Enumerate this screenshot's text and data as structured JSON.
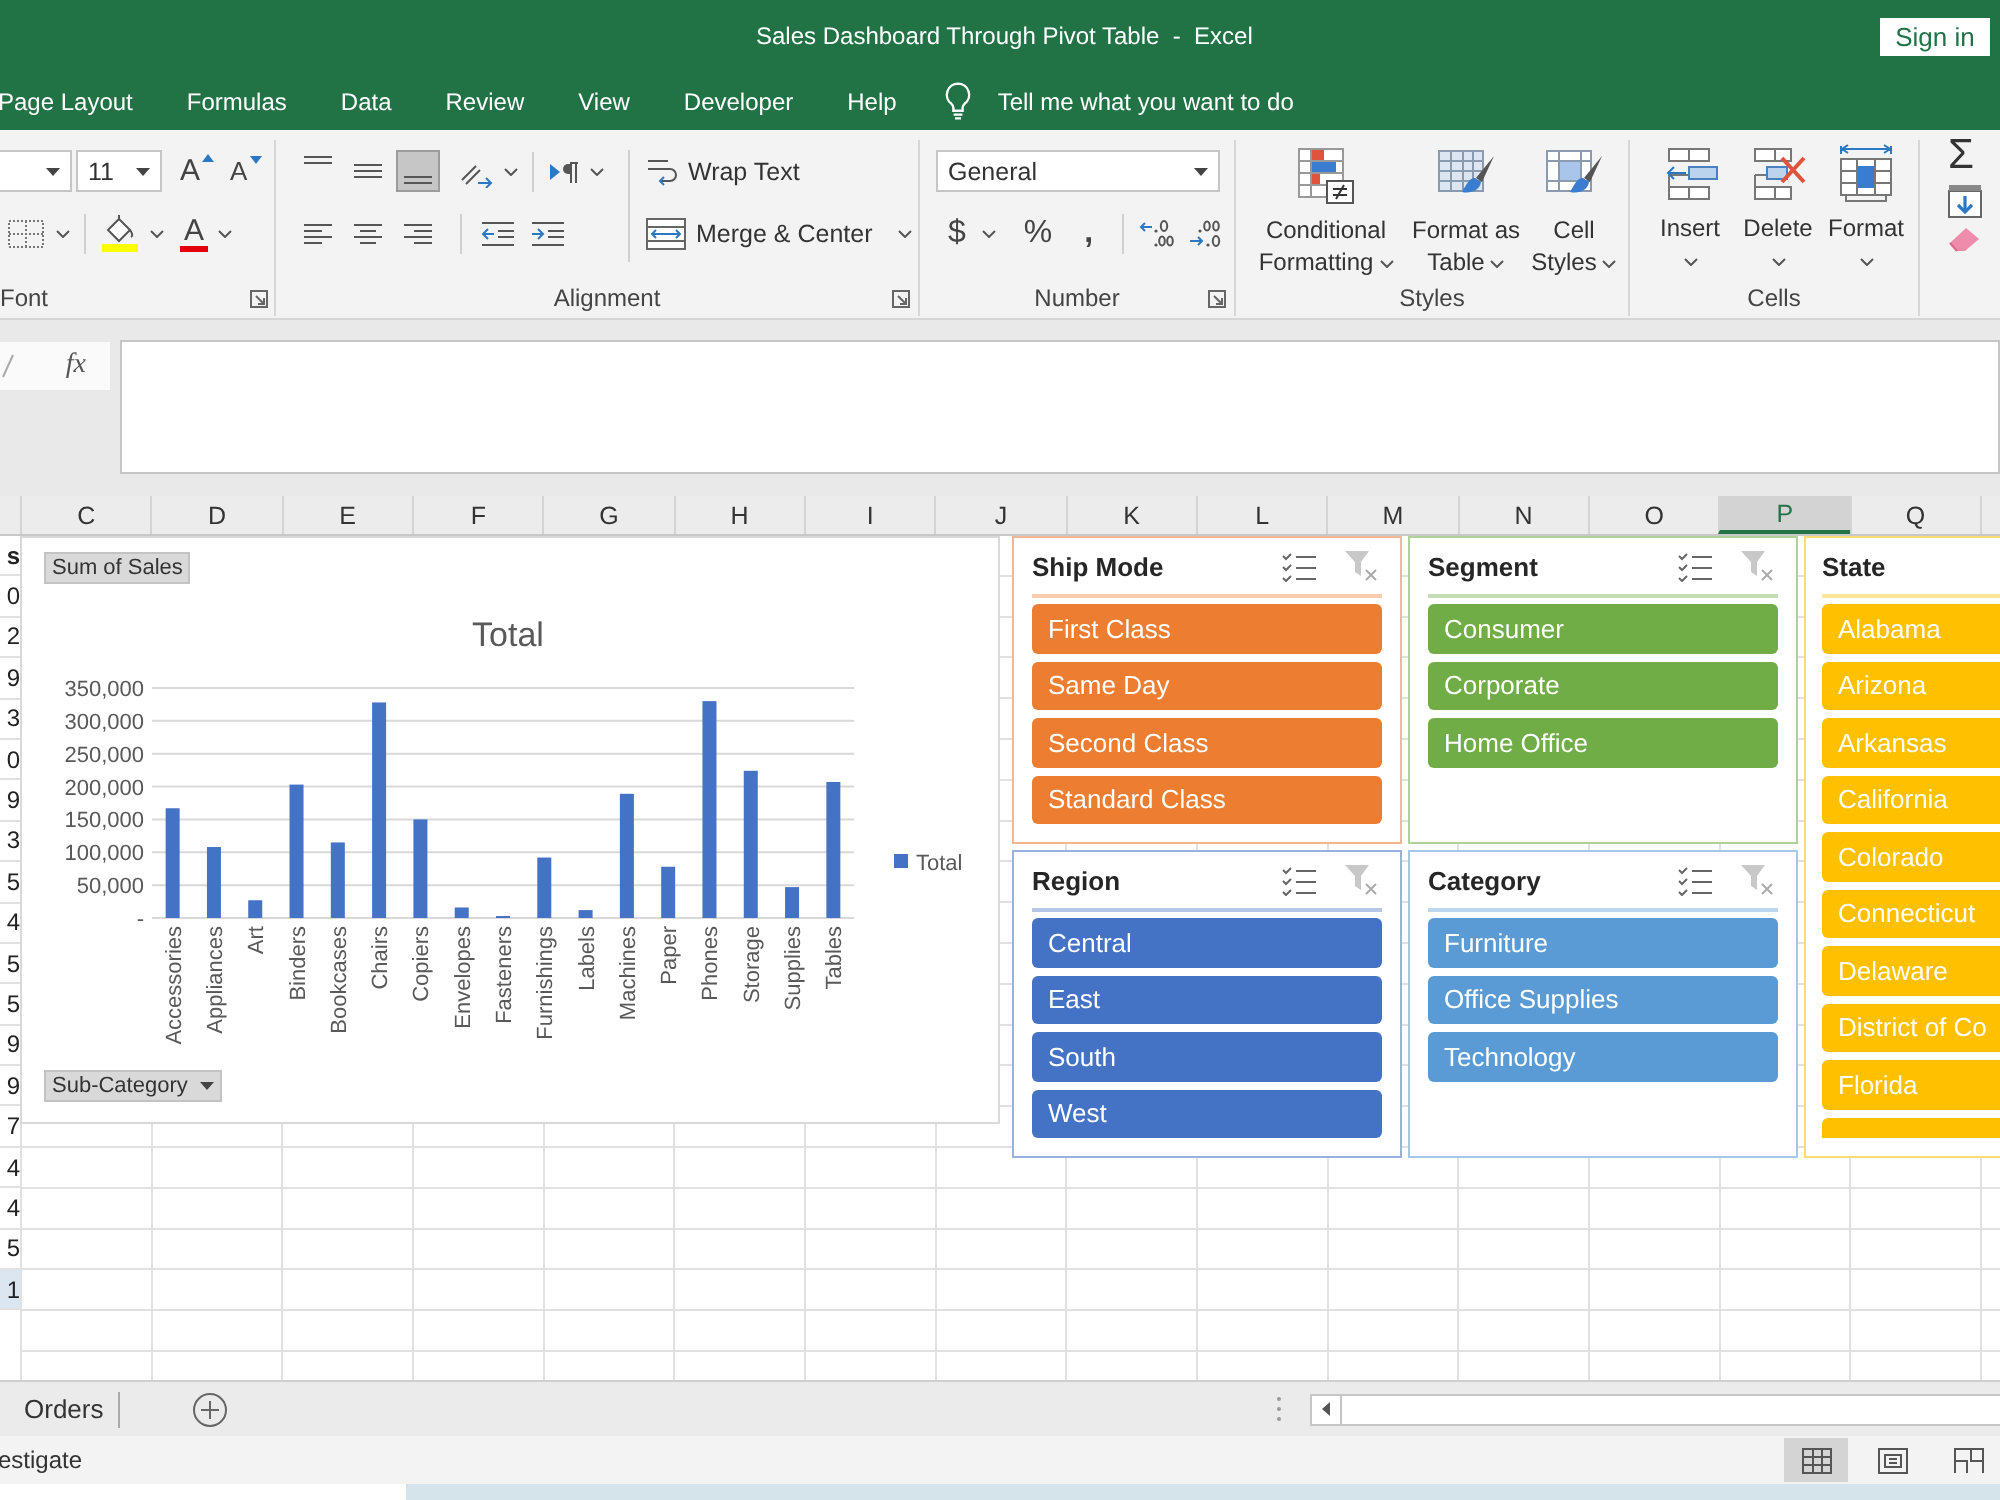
{
  "window": {
    "title": "Sales Dashboard Through Pivot Table  -  Excel",
    "sign_in": "Sign in"
  },
  "menu_tabs": [
    {
      "label": "Page Layout",
      "selected": false
    },
    {
      "label": "Formulas",
      "selected": false
    },
    {
      "label": "Data",
      "selected": false
    },
    {
      "label": "Review",
      "selected": false
    },
    {
      "label": "View",
      "selected": false
    },
    {
      "label": "Developer",
      "selected": false
    },
    {
      "label": "Help",
      "selected": false
    }
  ],
  "tell_me": {
    "label": "Tell me what you want to do"
  },
  "ribbon": {
    "font": {
      "label": "Font",
      "size": "11",
      "grow": "A",
      "shrink": "A",
      "font_color": "A"
    },
    "alignment": {
      "label": "Alignment",
      "vertical": [
        {
          "kind": "top",
          "selected": false
        },
        {
          "kind": "middle",
          "selected": false
        },
        {
          "kind": "bottom",
          "selected": true
        }
      ],
      "horizontal": [
        {
          "kind": "left",
          "selected": false
        },
        {
          "kind": "center",
          "selected": false
        },
        {
          "kind": "right",
          "selected": false
        }
      ],
      "wrap_text": "Wrap Text",
      "merge": "Merge & Center"
    },
    "number": {
      "label": "Number",
      "format": "General",
      "currency": "$",
      "percent": "%",
      "comma": ","
    },
    "styles": {
      "label": "Styles",
      "buttons": [
        {
          "kind": "conditional",
          "lines": [
            "Conditional",
            "Formatting"
          ]
        },
        {
          "kind": "table",
          "lines": [
            "Format as",
            "Table"
          ]
        },
        {
          "kind": "cell",
          "lines": [
            "Cell",
            "Styles"
          ]
        }
      ]
    },
    "cells": {
      "label": "Cells",
      "buttons": [
        {
          "kind": "insert",
          "label": "Insert"
        },
        {
          "kind": "delete",
          "label": "Delete"
        },
        {
          "kind": "format",
          "label": "Format"
        }
      ]
    },
    "editing": {
      "sum": "Σ"
    }
  },
  "formula_bar": {
    "function_button": "fx"
  },
  "columns": [
    {
      "label": "C",
      "selected": false
    },
    {
      "label": "D",
      "selected": false
    },
    {
      "label": "E",
      "selected": false
    },
    {
      "label": "F",
      "selected": false
    },
    {
      "label": "G",
      "selected": false
    },
    {
      "label": "H",
      "selected": false
    },
    {
      "label": "I",
      "selected": false
    },
    {
      "label": "J",
      "selected": false
    },
    {
      "label": "K",
      "selected": false
    },
    {
      "label": "L",
      "selected": false
    },
    {
      "label": "M",
      "selected": false
    },
    {
      "label": "N",
      "selected": false
    },
    {
      "label": "O",
      "selected": false
    },
    {
      "label": "P",
      "selected": true
    },
    {
      "label": "Q",
      "selected": false
    }
  ],
  "column_b": [
    {
      "text": "s",
      "kind": "header"
    },
    {
      "text": "0",
      "kind": "value"
    },
    {
      "text": "2",
      "kind": "value"
    },
    {
      "text": "9",
      "kind": "value"
    },
    {
      "text": "3",
      "kind": "value"
    },
    {
      "text": "0",
      "kind": "value"
    },
    {
      "text": "9",
      "kind": "value"
    },
    {
      "text": "3",
      "kind": "value"
    },
    {
      "text": "5",
      "kind": "value"
    },
    {
      "text": "4",
      "kind": "value"
    },
    {
      "text": "5",
      "kind": "value"
    },
    {
      "text": "5",
      "kind": "value"
    },
    {
      "text": "9",
      "kind": "value"
    },
    {
      "text": "9",
      "kind": "value"
    },
    {
      "text": "7",
      "kind": "value"
    },
    {
      "text": "4",
      "kind": "value"
    },
    {
      "text": "4",
      "kind": "value"
    },
    {
      "text": "5",
      "kind": "value"
    },
    {
      "text": "1",
      "kind": "total"
    }
  ],
  "chart": {
    "sum_button": "Sum of Sales",
    "field_button": "Sub-Category",
    "chart_data": {
      "type": "bar",
      "title": "Total",
      "categories": [
        "Accessories",
        "Appliances",
        "Art",
        "Binders",
        "Bookcases",
        "Chairs",
        "Copiers",
        "Envelopes",
        "Fasteners",
        "Furnishings",
        "Labels",
        "Machines",
        "Paper",
        "Phones",
        "Storage",
        "Supplies",
        "Tables"
      ],
      "series": [
        {
          "name": "Total",
          "color": "#4472c4",
          "values": [
            167000,
            108000,
            27000,
            203000,
            115000,
            328000,
            150000,
            16000,
            3000,
            92000,
            12000,
            189000,
            78000,
            330000,
            224000,
            47000,
            207000
          ]
        }
      ],
      "ylim": [
        0,
        350000
      ],
      "yticks": [
        {
          "value": 0,
          "label": "-"
        },
        {
          "value": 50000,
          "label": "50,000"
        },
        {
          "value": 100000,
          "label": "100,000"
        },
        {
          "value": 150000,
          "label": "150,000"
        },
        {
          "value": 200000,
          "label": "200,000"
        },
        {
          "value": 250000,
          "label": "250,000"
        },
        {
          "value": 300000,
          "label": "300,000"
        },
        {
          "value": 350000,
          "label": "350,000"
        }
      ],
      "grid": true
    }
  },
  "slicer_columns": [
    {
      "slicers": [
        {
          "title": "Ship Mode",
          "color": "#ed7d31",
          "cut_off": false,
          "items": [
            {
              "label": "First Class",
              "selected": true
            },
            {
              "label": "Same Day",
              "selected": true
            },
            {
              "label": "Second Class",
              "selected": true
            },
            {
              "label": "Standard Class",
              "selected": true
            }
          ]
        },
        {
          "title": "Region",
          "color": "#4472c4",
          "cut_off": false,
          "items": [
            {
              "label": "Central",
              "selected": true
            },
            {
              "label": "East",
              "selected": true
            },
            {
              "label": "South",
              "selected": true
            },
            {
              "label": "West",
              "selected": true
            }
          ]
        }
      ]
    },
    {
      "slicers": [
        {
          "title": "Segment",
          "color": "#70ad47",
          "cut_off": false,
          "items": [
            {
              "label": "Consumer",
              "selected": true
            },
            {
              "label": "Corporate",
              "selected": true
            },
            {
              "label": "Home Office",
              "selected": true
            }
          ]
        },
        {
          "title": "Category",
          "color": "#5b9bd5",
          "cut_off": false,
          "items": [
            {
              "label": "Furniture",
              "selected": true
            },
            {
              "label": "Office Supplies",
              "selected": true
            },
            {
              "label": "Technology",
              "selected": true
            }
          ]
        }
      ]
    },
    {
      "slicers": [
        {
          "title": "State",
          "color": "#ffc000",
          "cut_off": true,
          "items": [
            {
              "label": "Alabama",
              "selected": true
            },
            {
              "label": "Arizona",
              "selected": true
            },
            {
              "label": "Arkansas",
              "selected": true
            },
            {
              "label": "California",
              "selected": true
            },
            {
              "label": "Colorado",
              "selected": true
            },
            {
              "label": "Connecticut",
              "selected": true
            },
            {
              "label": "Delaware",
              "selected": true
            },
            {
              "label": "District of Co",
              "selected": true
            },
            {
              "label": "Florida",
              "selected": true
            }
          ]
        }
      ]
    }
  ],
  "sheet_tabs": [
    {
      "label": "Orders",
      "selected": false
    }
  ],
  "status_bar": {
    "text": "estigate",
    "views": [
      {
        "kind": "normal",
        "selected": true
      },
      {
        "kind": "page_layout",
        "selected": false
      },
      {
        "kind": "page_break",
        "selected": false
      }
    ]
  }
}
